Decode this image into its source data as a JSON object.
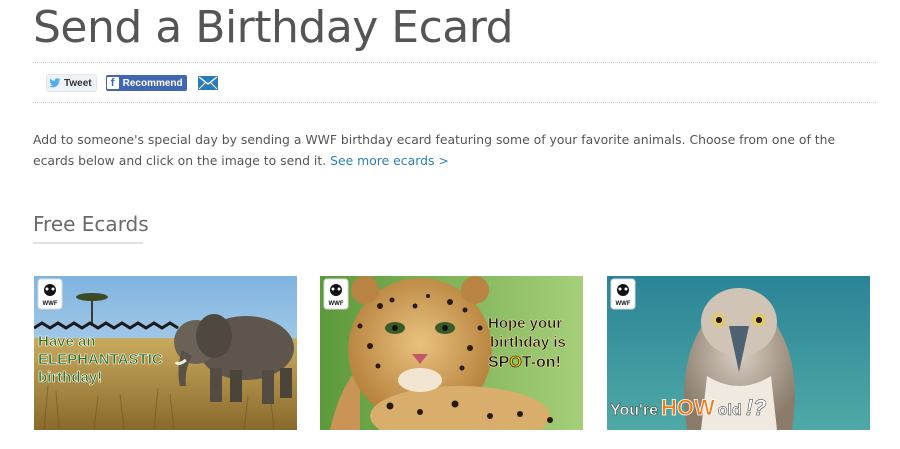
{
  "page": {
    "title": "Send a Birthday Ecard"
  },
  "share": {
    "tweet_label": "Tweet",
    "facebook_label": "Recommend",
    "email_icon": "envelope-icon"
  },
  "intro": {
    "text": "Add to someone's special day by sending a WWF birthday ecard featuring some of your favorite animals. Choose from one of the ecards below and click on the image to send it. ",
    "link": "See more ecards >"
  },
  "section": {
    "title": "Free Ecards"
  },
  "ecards": [
    {
      "logo": "WWF",
      "line1": "Have an",
      "line2": "ELEPHANTASTIC",
      "line3": "birthday!"
    },
    {
      "logo": "WWF",
      "line1": "Hope your",
      "line2": "birthday is",
      "line3a": "SP",
      "line3b": "O",
      "line3c": "T-on!"
    },
    {
      "logo": "WWF",
      "part1": "You're",
      "part2": "HOW",
      "part3": "old",
      "part4": "!?"
    }
  ],
  "colors": {
    "link": "#2d7fb7",
    "facebook": "#4267b2",
    "elephant_green": "#2e6b1f",
    "leopard_text": "#111111",
    "booby_orange": "#f07a1a"
  }
}
